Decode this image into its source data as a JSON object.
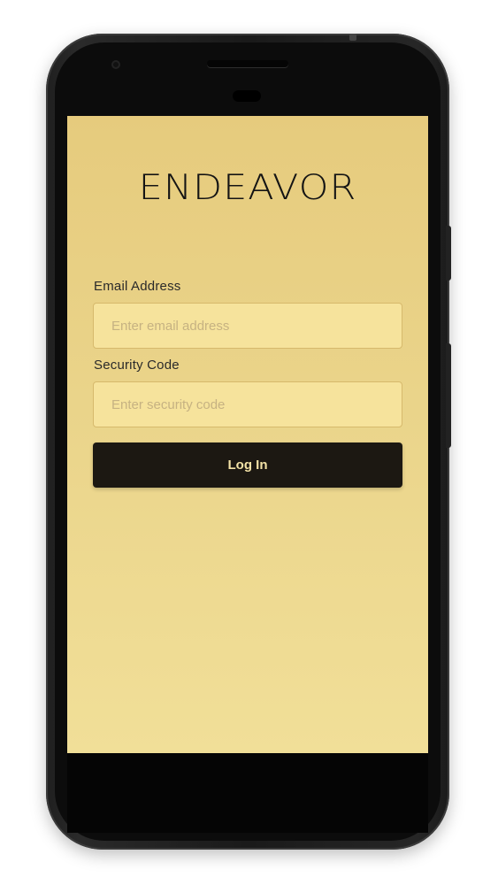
{
  "app": {
    "brand": "ENDEAVOR"
  },
  "form": {
    "email": {
      "label": "Email Address",
      "placeholder": "Enter email address",
      "value": ""
    },
    "security_code": {
      "label": "Security Code",
      "placeholder": "Enter security code",
      "value": ""
    },
    "login_label": "Log In"
  },
  "colors": {
    "screen_background": "#e8cf83",
    "input_background": "#f6e39c",
    "button_background": "#1c1812",
    "button_text": "#f3e2a6",
    "device_frame": "#1f1f1f"
  },
  "icons": {
    "camera": "camera-icon",
    "speaker": "speaker-grille-icon",
    "sensor": "sensor-icon"
  }
}
